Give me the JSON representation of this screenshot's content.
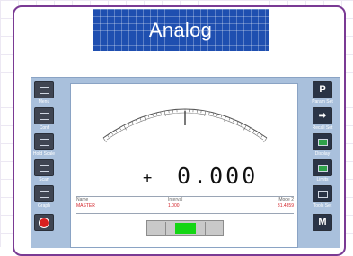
{
  "header": {
    "title": "Analog"
  },
  "colors": {
    "accent": "#7a3a94",
    "banner": "#1f4fb0",
    "value_red": "#d2242a",
    "bar_green": "#14d614"
  },
  "left_toolbar": [
    {
      "icon": "menu-icon",
      "label": "Menu"
    },
    {
      "icon": "contrast-icon",
      "label": "Conf"
    },
    {
      "icon": "add-scale-icon",
      "label": "Hold Scale"
    },
    {
      "icon": "waveform-icon",
      "label": "Scan"
    },
    {
      "icon": "trend-icon",
      "label": "Graph"
    },
    {
      "icon": "stop-icon",
      "label": "STOP"
    }
  ],
  "right_toolbar": [
    {
      "glyph": "P",
      "icon": "print-icon",
      "label": "Param Set"
    },
    {
      "glyph": "",
      "icon": "arrow-right-icon",
      "label": "Recall Set"
    },
    {
      "glyph": "",
      "icon": "chart-icon",
      "label": "Display"
    },
    {
      "glyph": "",
      "icon": "level-icon",
      "label": "Limits"
    },
    {
      "glyph": "",
      "icon": "tools-icon",
      "label": "Tools Set"
    },
    {
      "glyph": "M",
      "icon": "memory-icon",
      "label": "Memory"
    }
  ],
  "gauge": {
    "reading_sign": "+",
    "reading": "0.000",
    "needle_position": 0.5
  },
  "info_table": {
    "headers": [
      "Name",
      "Interval",
      "Mode 2"
    ],
    "values": [
      "MASTER",
      "1.000",
      "31.4859"
    ]
  },
  "level_bar": {
    "fill_fraction": 0.27
  }
}
